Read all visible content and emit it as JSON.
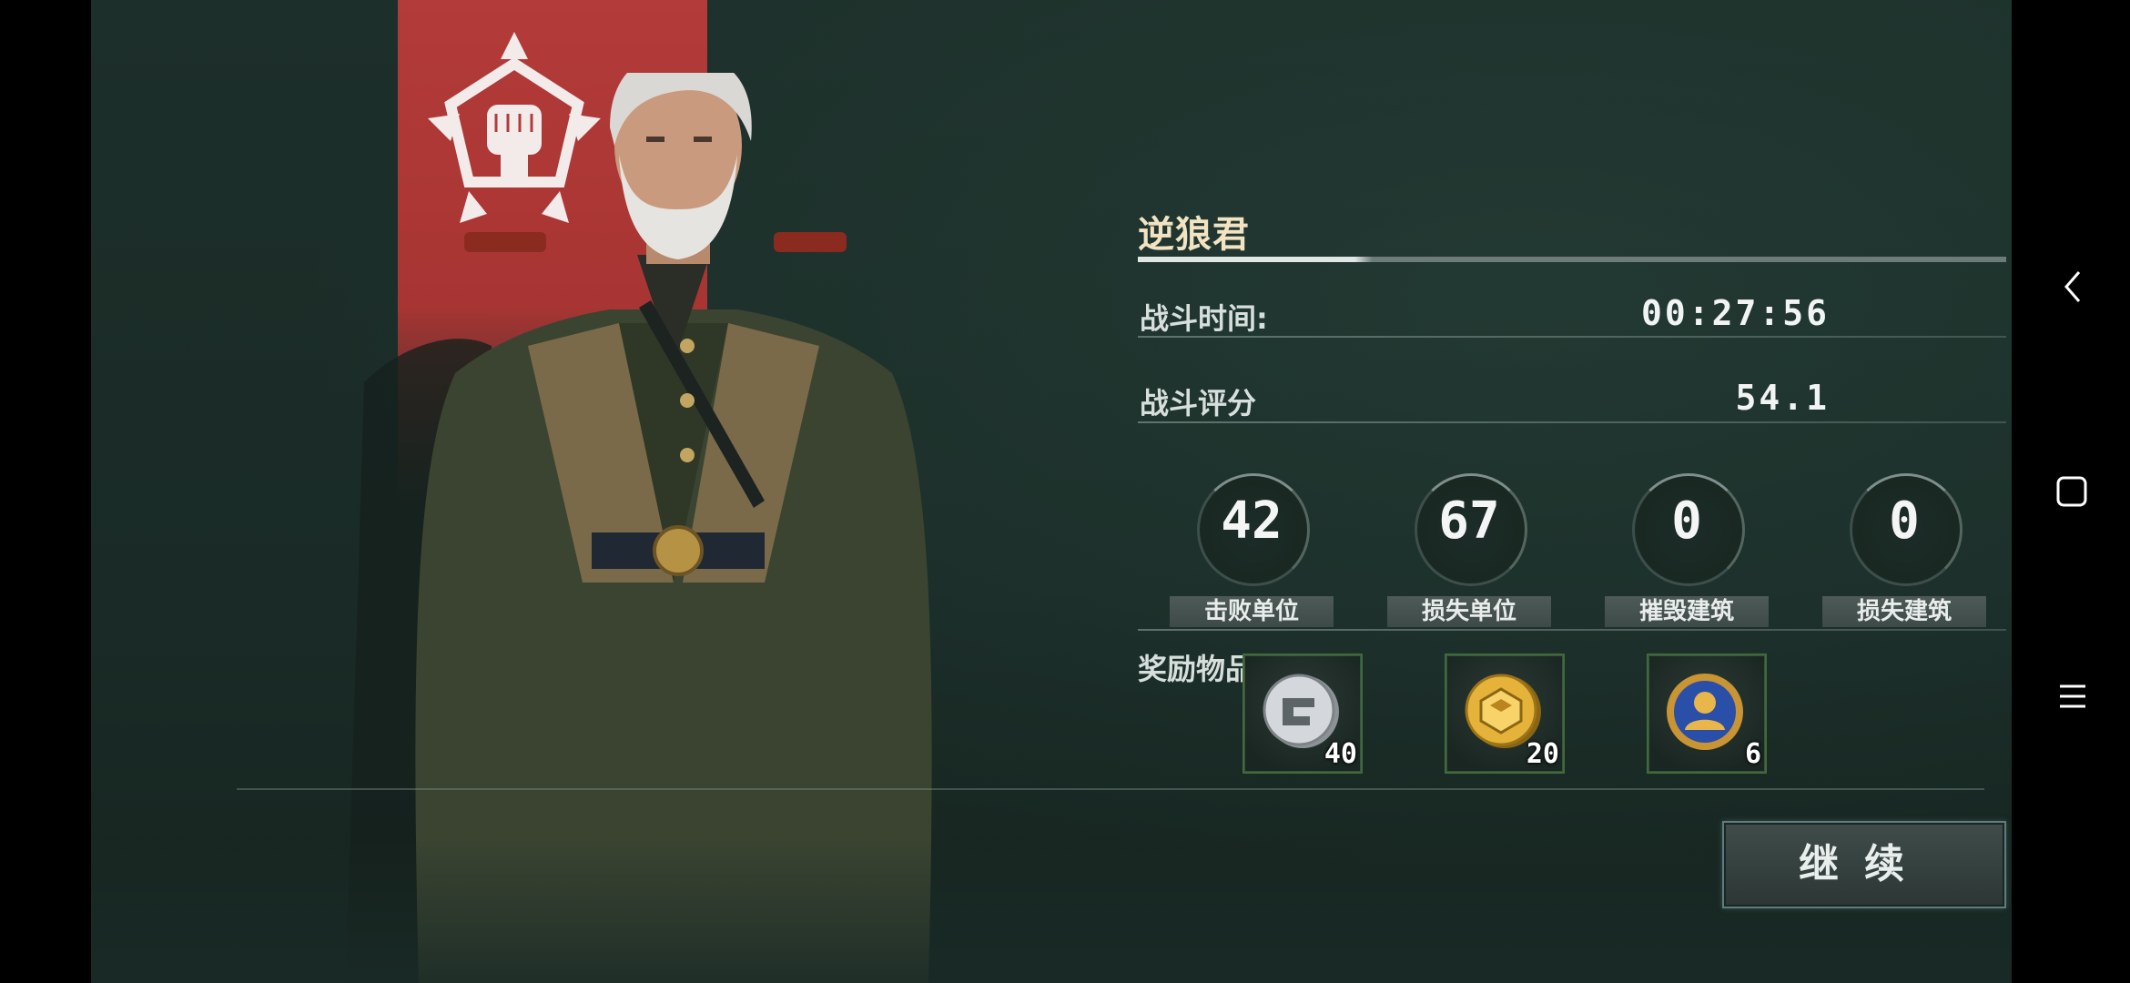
{
  "player": {
    "name": "逆狼君"
  },
  "stats": {
    "time_label": "战斗时间:",
    "time_value": "00:27:56",
    "score_label": "战斗评分",
    "score_value": "54.1"
  },
  "counters": [
    {
      "label": "击败单位",
      "value": "42"
    },
    {
      "label": "损失单位",
      "value": "67"
    },
    {
      "label": "摧毁建筑",
      "value": "0"
    },
    {
      "label": "损失建筑",
      "value": "0"
    }
  ],
  "rewards": {
    "label": "奖励物品:",
    "items": [
      {
        "icon": "silver-coin-icon",
        "quantity": "40"
      },
      {
        "icon": "gold-coin-icon",
        "quantity": "20"
      },
      {
        "icon": "badge-medal-icon",
        "quantity": "6"
      }
    ]
  },
  "continue_button": {
    "label": "继续"
  },
  "nav": {
    "back_icon": "back-icon",
    "home_icon": "home-icon",
    "menu_icon": "menu-icon"
  },
  "colors": {
    "banner": "#b33b39",
    "background": "#1d2f2a",
    "title_gold": "#f2e4c2"
  }
}
